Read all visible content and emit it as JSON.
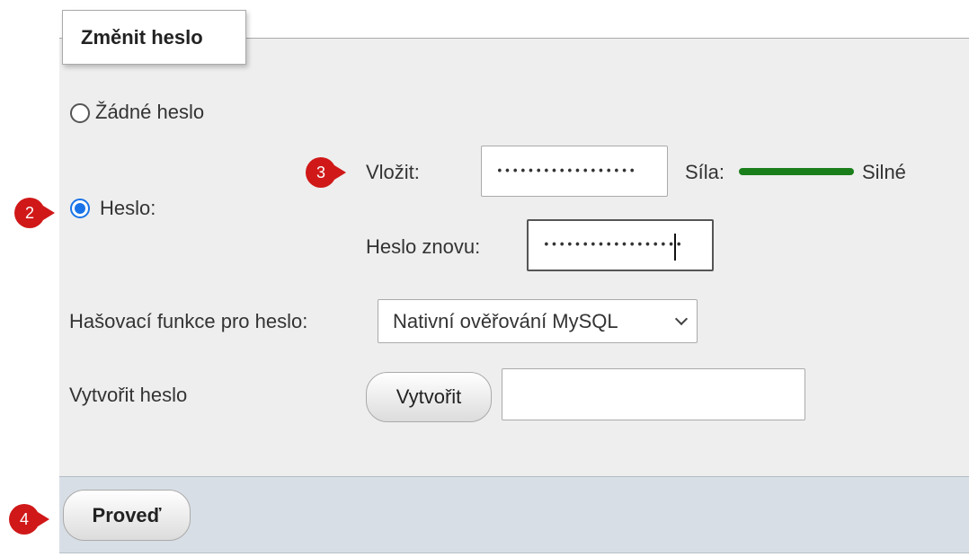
{
  "fieldset": {
    "legend": "Změnit heslo"
  },
  "options": {
    "no_password_label": "Žádné heslo",
    "password_label": "Heslo:"
  },
  "password": {
    "enter_label": "Vložit:",
    "enter_value": "••••••••••••••••••",
    "strength_label": "Síla:",
    "strength_value": "Silné",
    "strength_color": "#1a7f1a",
    "retype_label": "Heslo znovu:",
    "retype_value": "••••••••••••••••••"
  },
  "hashing": {
    "label": "Hašovací funkce pro heslo:",
    "selected": "Nativní ověřování MySQL"
  },
  "generate": {
    "label": "Vytvořit heslo",
    "button": "Vytvořit",
    "value": ""
  },
  "footer": {
    "submit": "Proveď"
  },
  "annotations": {
    "badge_2": "2",
    "badge_3": "3",
    "badge_4": "4",
    "color": "#d01818"
  }
}
